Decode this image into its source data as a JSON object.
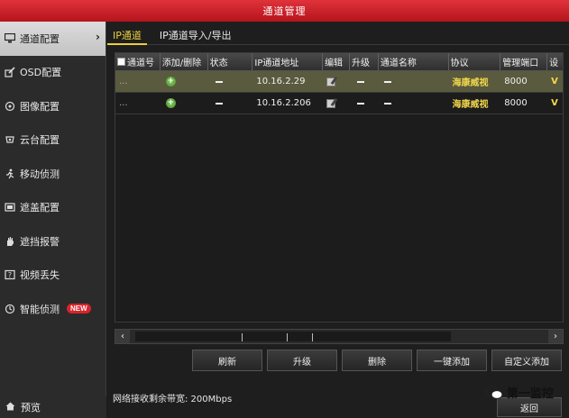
{
  "window": {
    "title": "通道管理"
  },
  "sidebar": {
    "items": [
      {
        "label": "通道配置",
        "icon": "monitor-icon",
        "active": true
      },
      {
        "label": "OSD配置",
        "icon": "pencil-icon"
      },
      {
        "label": "图像配置",
        "icon": "image-icon"
      },
      {
        "label": "云台配置",
        "icon": "ptz-icon"
      },
      {
        "label": "移动侦测",
        "icon": "running-man-icon"
      },
      {
        "label": "遮盖配置",
        "icon": "mask-icon"
      },
      {
        "label": "遮挡报警",
        "icon": "hand-icon"
      },
      {
        "label": "视频丢失",
        "icon": "video-loss-icon"
      },
      {
        "label": "智能侦测",
        "icon": "smart-detect-icon",
        "badge": "NEW"
      }
    ],
    "preview_label": "预览"
  },
  "tabs": [
    {
      "label": "IP通道",
      "active": true
    },
    {
      "label": "IP通道导入/导出"
    }
  ],
  "table": {
    "columns": [
      "通道号",
      "添加/删除",
      "状态",
      "IP通道地址",
      "编辑",
      "升级",
      "通道名称",
      "协议",
      "管理端口",
      "设"
    ],
    "rows": [
      {
        "channel": "...",
        "ip": "10.16.2.29",
        "protocol": "海康威视",
        "port": "8000",
        "extra": "V"
      },
      {
        "channel": "...",
        "ip": "10.16.2.206",
        "protocol": "海康威视",
        "port": "8000",
        "extra": "V"
      }
    ]
  },
  "actions": {
    "refresh": "刷新",
    "upgrade": "升级",
    "delete": "删除",
    "quick_add": "一键添加",
    "custom_add": "自定义添加"
  },
  "footer": {
    "bandwidth": "网络接收剩余带宽: 200Mbps",
    "back": "返回",
    "watermark": "第一监控"
  },
  "colors": {
    "title_bar": "#c81e26",
    "accent": "#e9cf3e",
    "protocol": "#f3d94a",
    "badge": "#d8232b"
  }
}
